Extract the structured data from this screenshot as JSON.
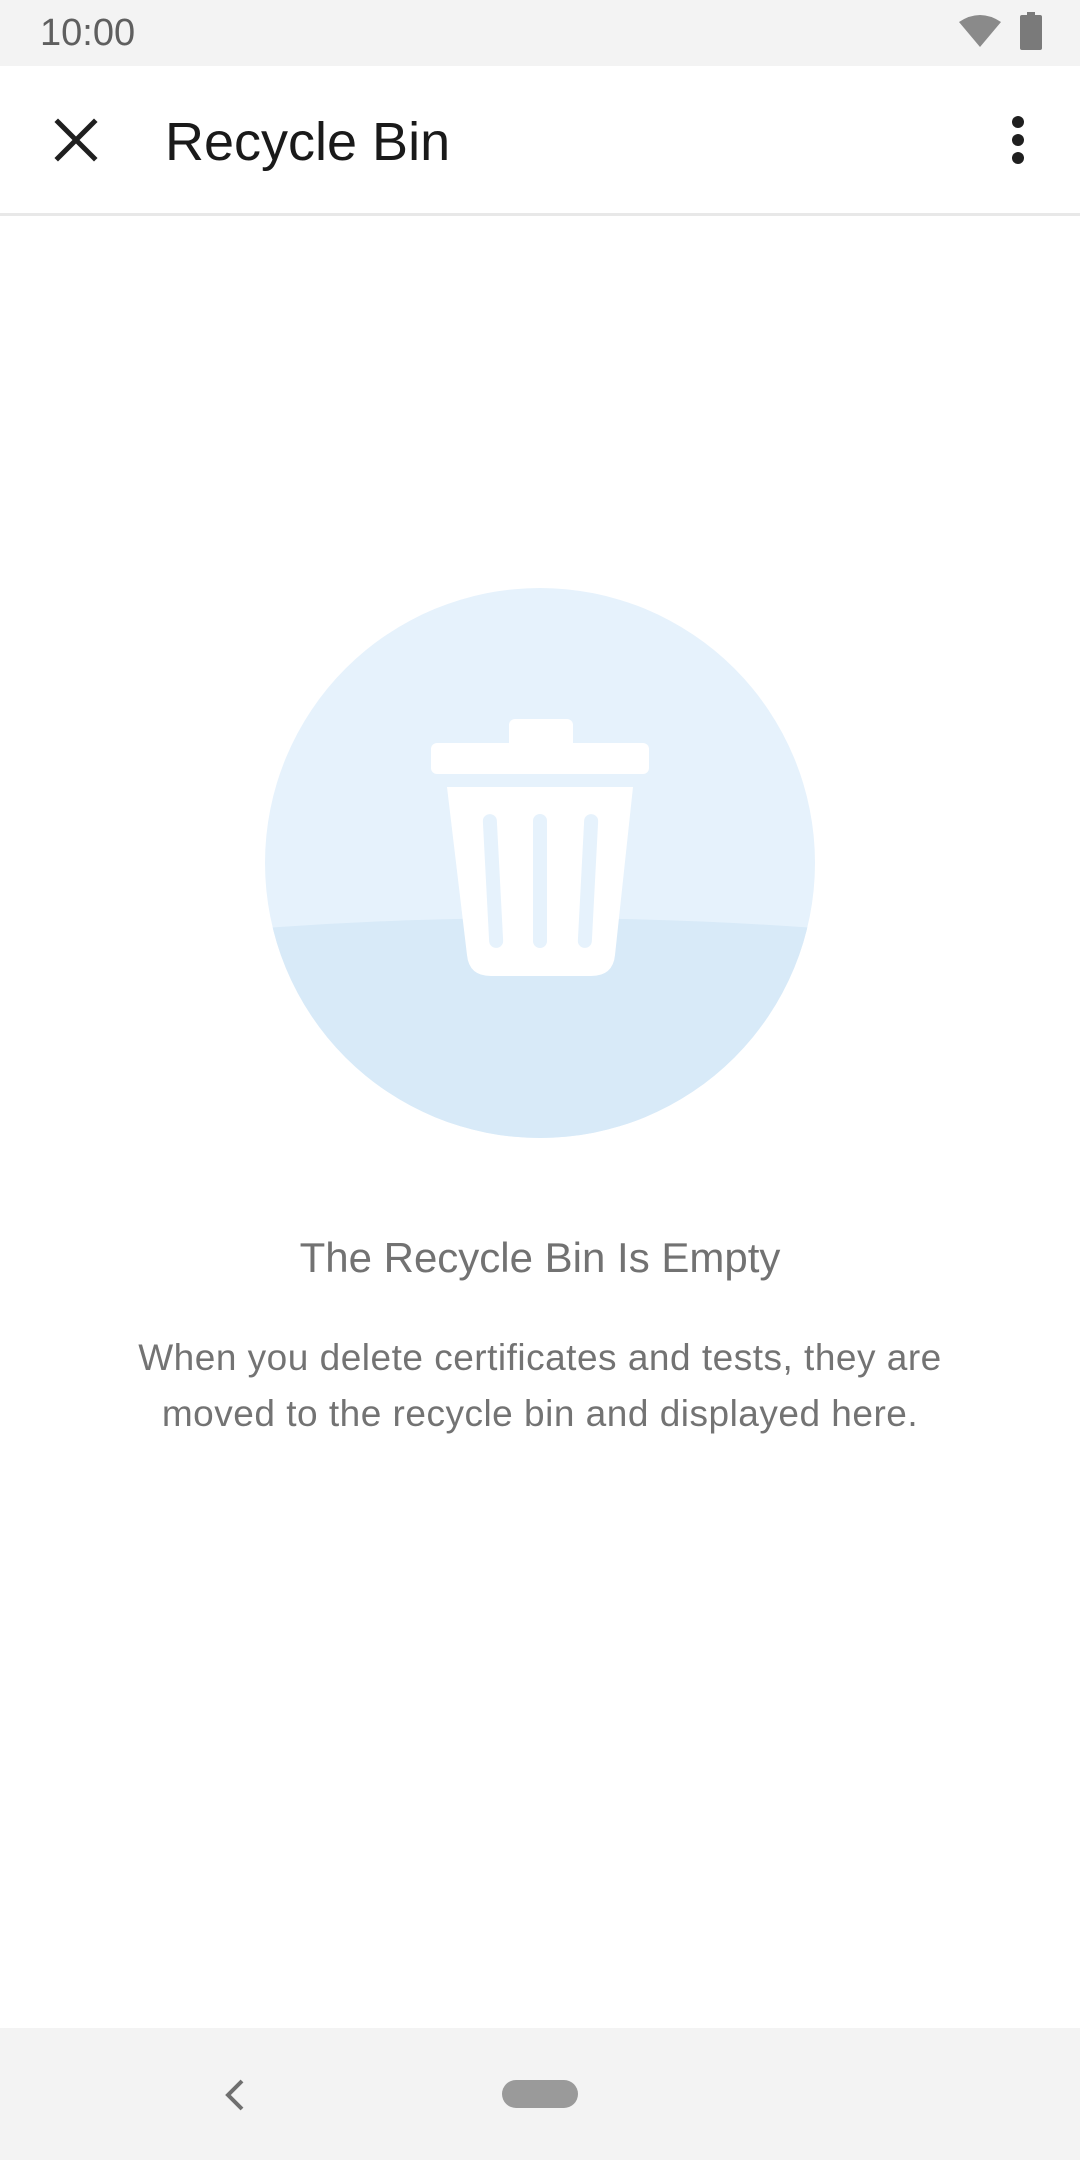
{
  "status_bar": {
    "time": "10:00",
    "icons": [
      "wifi-icon",
      "battery-icon"
    ]
  },
  "app_bar": {
    "title": "Recycle Bin",
    "close_icon": "close-icon",
    "overflow_icon": "more-vert-icon"
  },
  "empty_state": {
    "illustration_icon": "trash-bin-icon",
    "title": "The Recycle Bin Is Empty",
    "description": "When you delete certificates and tests, they are moved to the recycle bin and displayed here."
  },
  "nav_bar": {
    "back_icon": "back-icon",
    "home_icon": "home-pill-icon"
  },
  "colors": {
    "illustration_light": "#e6f2fc",
    "illustration_dark": "#d8eaf8",
    "bar_background": "#f3f3f3"
  }
}
